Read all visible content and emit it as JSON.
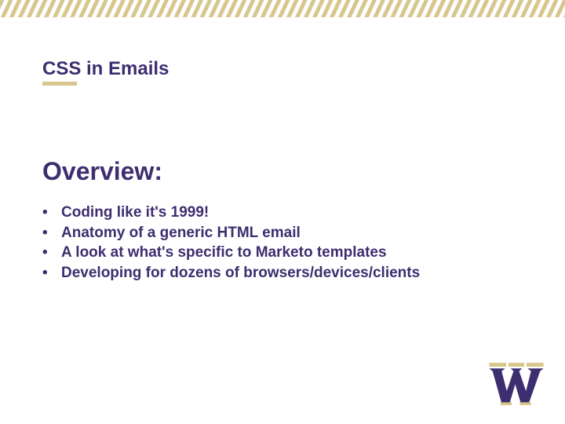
{
  "title": "CSS in Emails",
  "heading": "Overview:",
  "bullets": [
    "Coding like it's 1999!",
    "Anatomy of a generic HTML email",
    "A look at what's specific to Marketo templates",
    "Developing for dozens of browsers/devices/clients"
  ],
  "logo_name": "uw-w-logo"
}
